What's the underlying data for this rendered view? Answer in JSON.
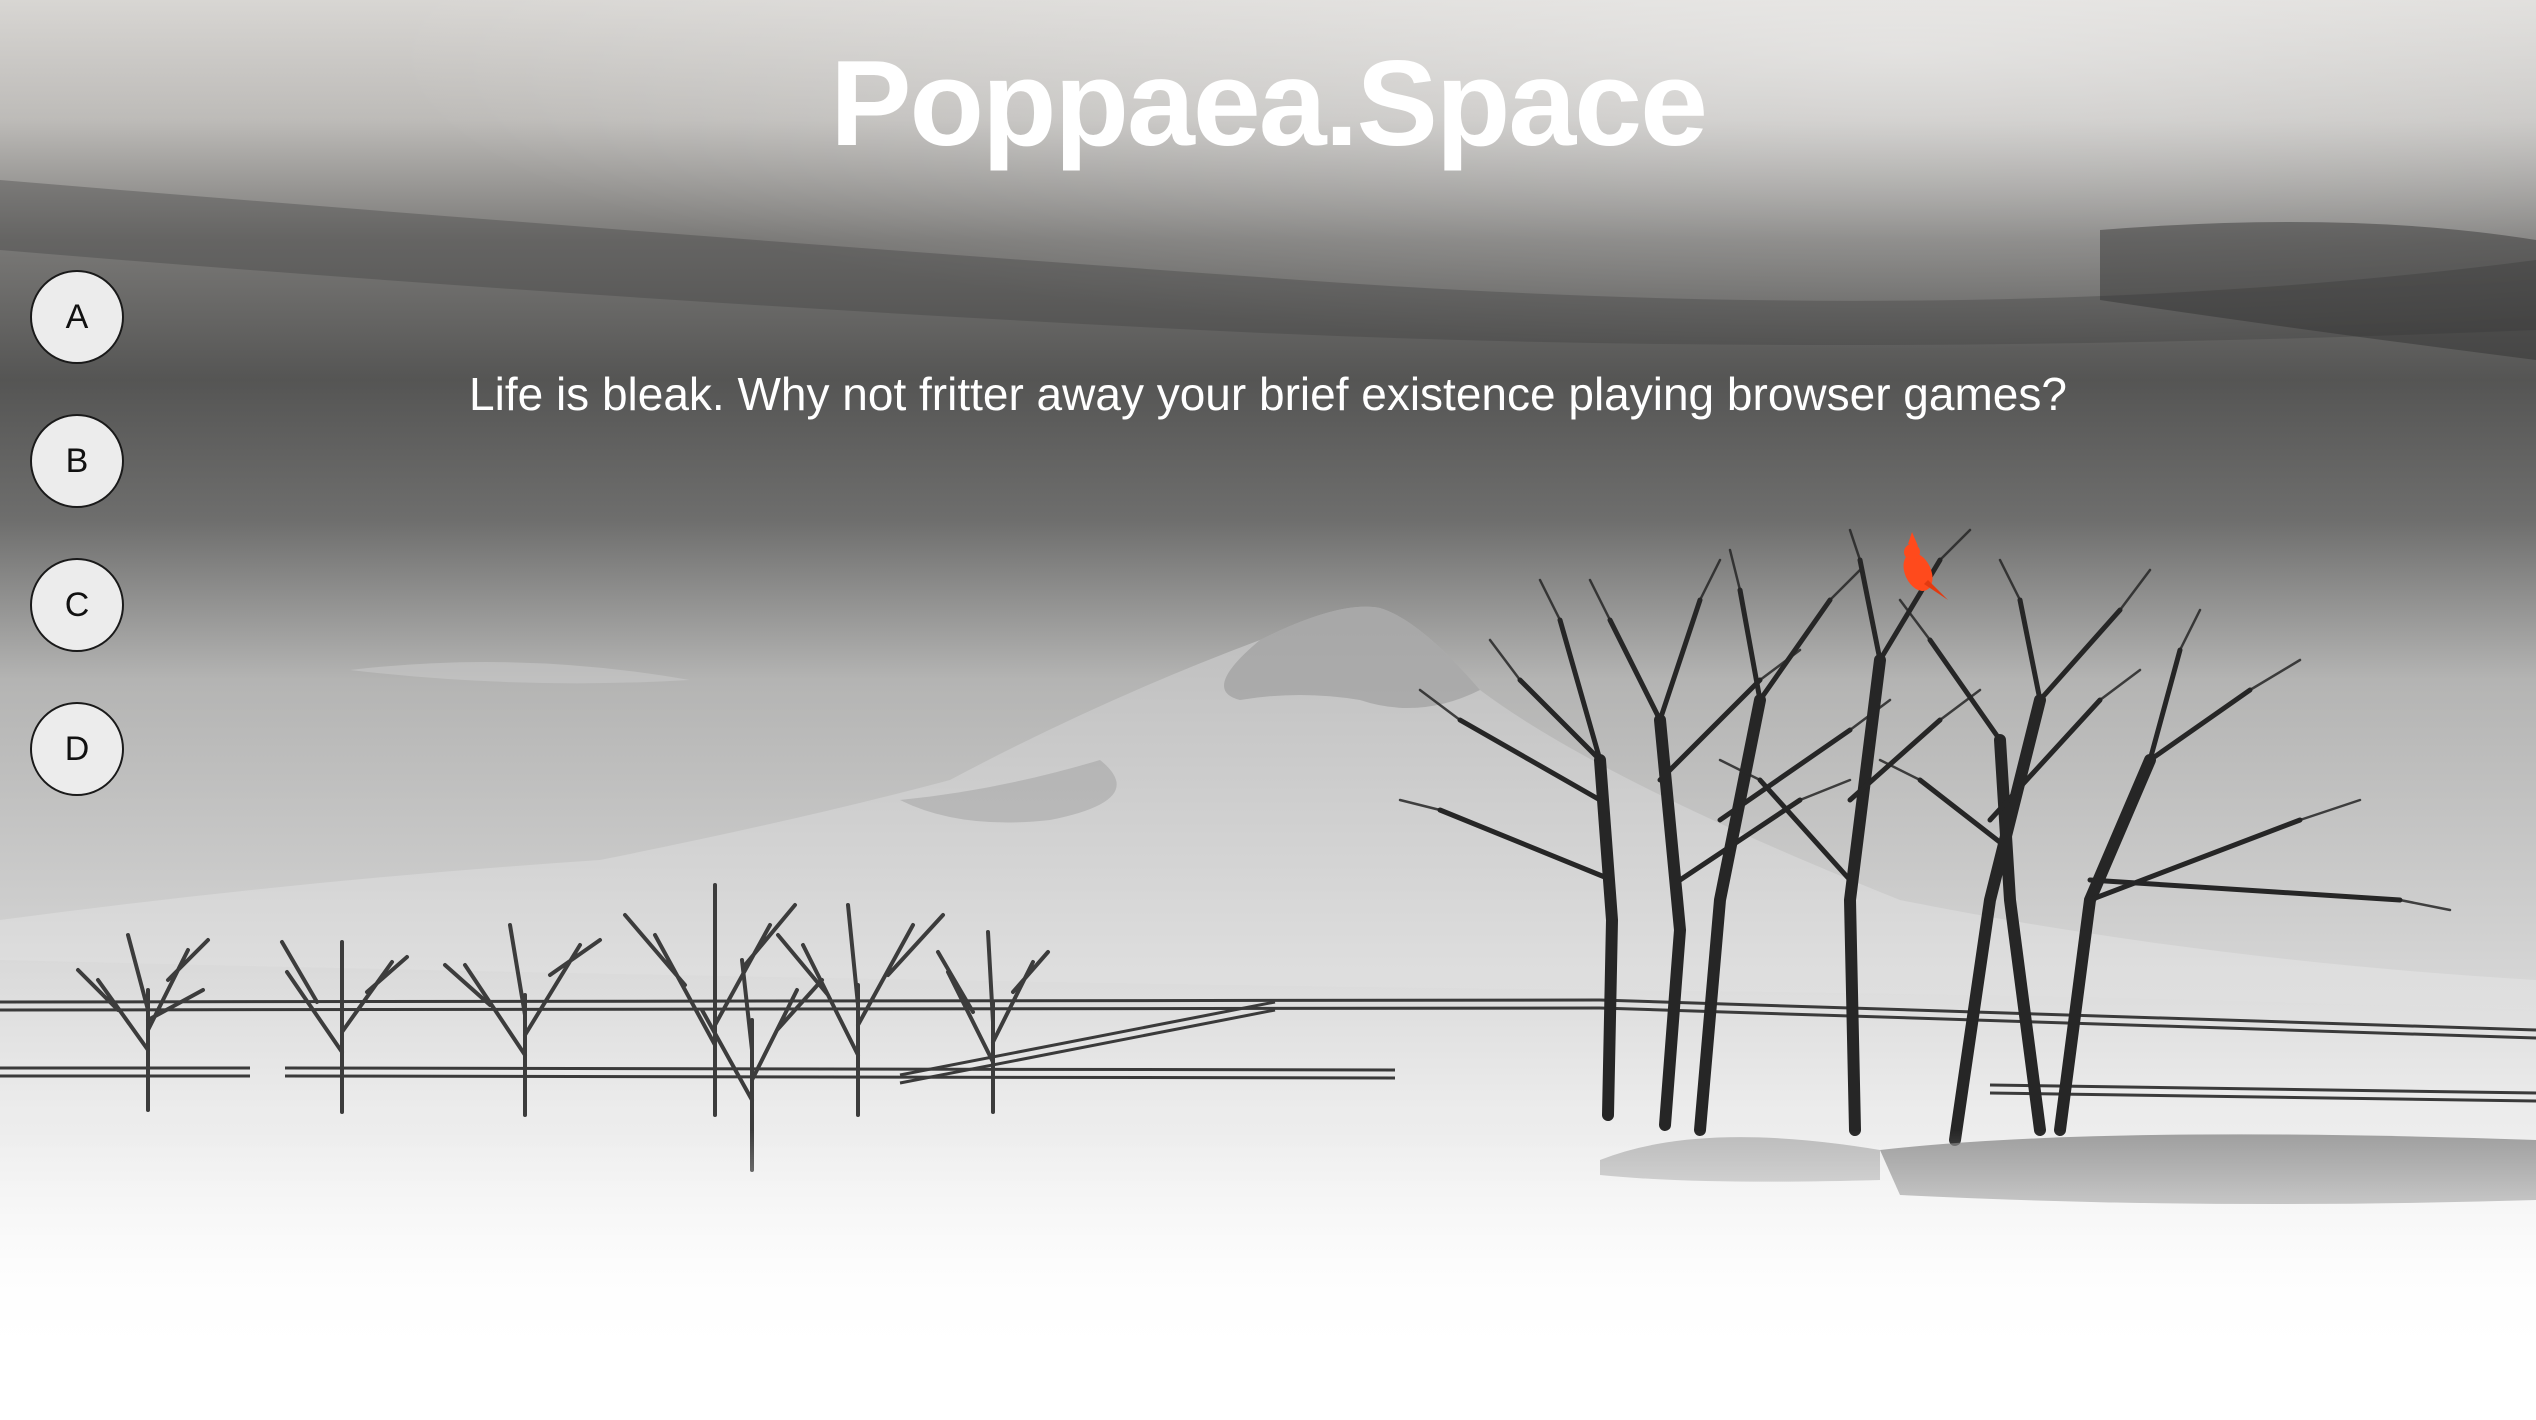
{
  "site": {
    "title": "Poppaea.Space",
    "tagline": "Life is bleak. Why not fritter away your brief existence playing browser games?"
  },
  "nav": {
    "items": [
      {
        "label": "A"
      },
      {
        "label": "B"
      },
      {
        "label": "C"
      },
      {
        "label": "D"
      }
    ]
  },
  "colors": {
    "bird": "#ff4a1c",
    "sky_dark": "#4a4a4a",
    "snow": "#f2f2f2"
  }
}
